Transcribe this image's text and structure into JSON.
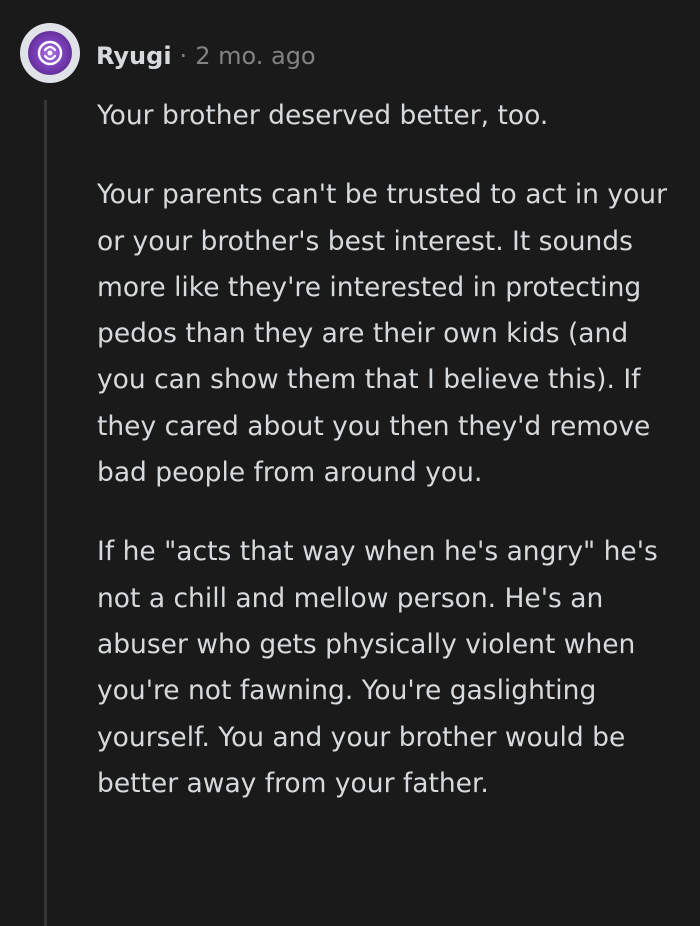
{
  "comment": {
    "username": "Ryugi",
    "separator": "·",
    "timestamp": "2 mo. ago",
    "avatar_icon": "snoo-avatar-icon",
    "paragraphs": [
      "Your brother deserved better, too.",
      "Your parents can't be trusted to act in your or your brother's best interest. It sounds more like they're interested in protecting pedos than they are their own kids (and you can show them that I believe this). If they cared about you then they'd remove bad people from around you.",
      "If he \"acts that way when he's angry\" he's not a chill and mellow person. He's an abuser who gets physically violent when you're not fawning. You're gaslighting yourself. You and your brother would be better away from your father."
    ]
  },
  "colors": {
    "background": "#1a1a1b",
    "text": "#d7dadc",
    "muted": "#818384",
    "thread_line": "#343536",
    "avatar_accent": "#7a3fb8"
  }
}
